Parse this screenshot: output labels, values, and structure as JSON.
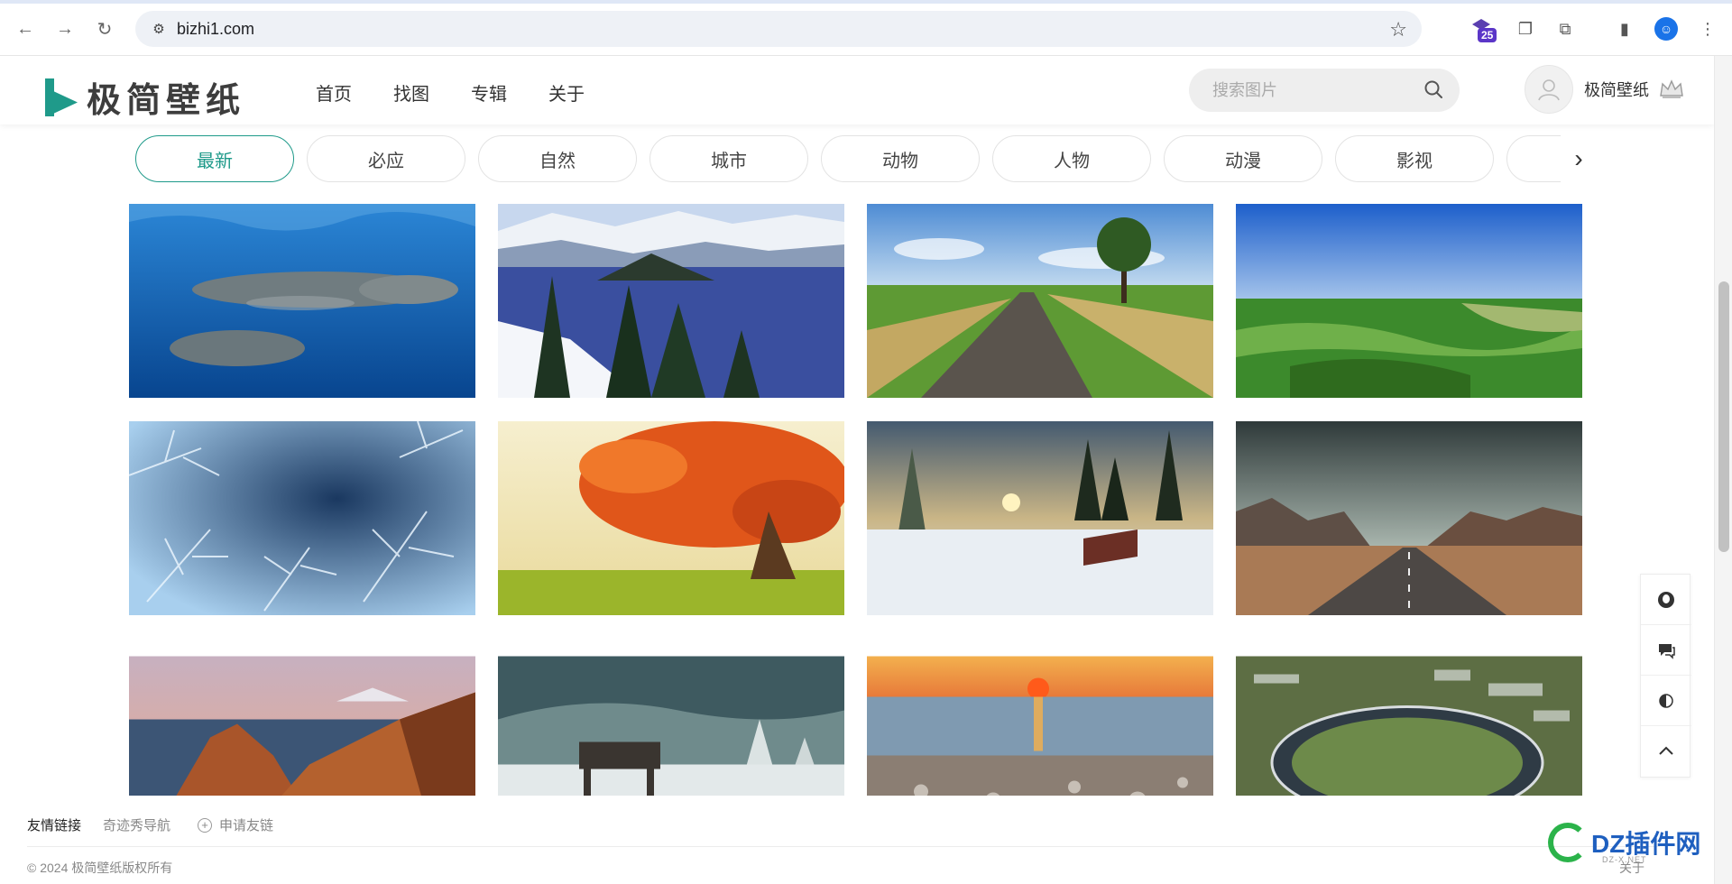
{
  "browser": {
    "url": "bizhi1.com",
    "extension_badge": "25"
  },
  "site": {
    "logo_text": "极简壁纸",
    "nav": [
      "首页",
      "找图",
      "专辑",
      "关于"
    ],
    "search_placeholder": "搜索图片",
    "username": "极简壁纸"
  },
  "categories": [
    {
      "label": "最新",
      "active": true
    },
    {
      "label": "必应",
      "active": false
    },
    {
      "label": "自然",
      "active": false
    },
    {
      "label": "城市",
      "active": false
    },
    {
      "label": "动物",
      "active": false
    },
    {
      "label": "人物",
      "active": false
    },
    {
      "label": "动漫",
      "active": false
    },
    {
      "label": "影视",
      "active": false
    }
  ],
  "wallpapers": [
    {
      "subject": "whales-underwater",
      "colors": [
        "#0a4f9a",
        "#1b7ac9",
        "#6a7f86"
      ]
    },
    {
      "subject": "crater-lake-winter",
      "colors": [
        "#e8eef6",
        "#3b4f9e",
        "#1f3b24"
      ]
    },
    {
      "subject": "country-road-tree",
      "colors": [
        "#7ab0de",
        "#63a03a",
        "#5c564e"
      ]
    },
    {
      "subject": "green-valley-aerial",
      "colors": [
        "#2e6fd0",
        "#3e8f2a",
        "#9bb86a"
      ]
    },
    {
      "subject": "frost-crystals",
      "colors": [
        "#1a3f6e",
        "#9cc7ea",
        "#e6f2fb"
      ]
    },
    {
      "subject": "autumn-tree",
      "colors": [
        "#f2e7b8",
        "#e55a1c",
        "#9ab52d"
      ]
    },
    {
      "subject": "winter-forest-sunset",
      "colors": [
        "#4d6278",
        "#e3c27a",
        "#e7ecf1"
      ]
    },
    {
      "subject": "desert-highway",
      "colors": [
        "#3c4a4a",
        "#a57552",
        "#5a514b"
      ]
    },
    {
      "subject": "coastal-cliffs-fuji",
      "colors": [
        "#e6a58a",
        "#b9602d",
        "#2e4660"
      ]
    },
    {
      "subject": "snowy-bench-forest",
      "colors": [
        "#3f5e63",
        "#d9e1e1",
        "#6f8b8c"
      ]
    },
    {
      "subject": "sunset-pebble-beach",
      "colors": [
        "#f08a3a",
        "#6b8fa6",
        "#8a7f75"
      ]
    },
    {
      "subject": "apple-park-aerial",
      "colors": [
        "#5d6e44",
        "#c9cfc7",
        "#2f3b45"
      ]
    }
  ],
  "footer": {
    "links_label": "友情链接",
    "links": [
      "奇迹秀导航"
    ],
    "apply_link": "申请友链",
    "copyright": "© 2024 极简壁纸版权所有",
    "about": "关于"
  },
  "watermark": {
    "text": "DZ插件网",
    "sub": "DZ-X.NET"
  }
}
